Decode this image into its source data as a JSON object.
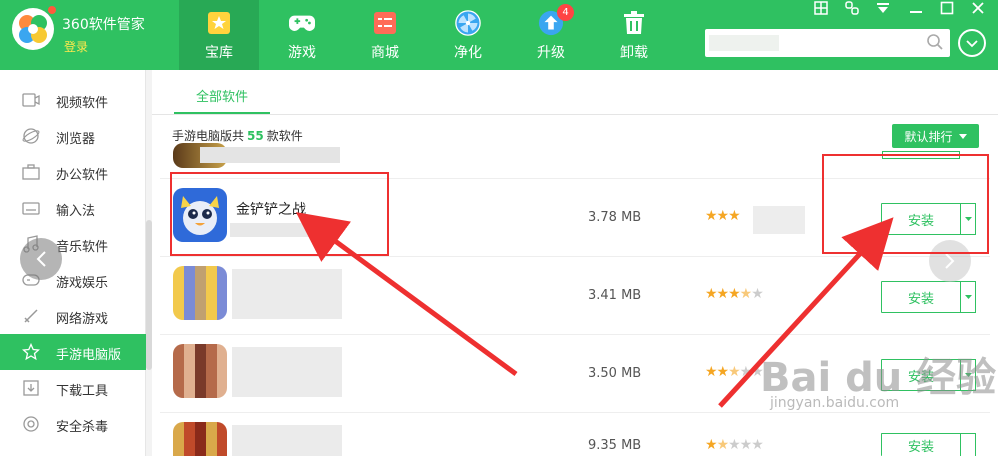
{
  "app": {
    "brand": "360软件管家",
    "login_label": "登录"
  },
  "tabs": [
    {
      "label": "宝库",
      "icon": "star-icon"
    },
    {
      "label": "游戏",
      "icon": "gamepad-icon"
    },
    {
      "label": "商城",
      "icon": "store-icon"
    },
    {
      "label": "净化",
      "icon": "purify-icon"
    },
    {
      "label": "升级",
      "icon": "upgrade-icon",
      "badge": "4"
    },
    {
      "label": "卸载",
      "icon": "trash-icon"
    }
  ],
  "search": {
    "placeholder": ""
  },
  "sidebar": {
    "items": [
      {
        "label": "视频软件"
      },
      {
        "label": "浏览器"
      },
      {
        "label": "办公软件"
      },
      {
        "label": "输入法"
      },
      {
        "label": "音乐软件"
      },
      {
        "label": "游戏娱乐"
      },
      {
        "label": "网络游戏"
      },
      {
        "label": "手游电脑版",
        "active": true
      },
      {
        "label": "下载工具"
      },
      {
        "label": "安全杀毒"
      }
    ]
  },
  "main": {
    "subtab": "全部软件",
    "count_prefix": "手游电脑版共",
    "count": "55",
    "count_suffix": "款软件",
    "sort_label": "默认排行"
  },
  "apps": [
    {
      "name": "金铲铲之战",
      "size": "3.78 MB",
      "stars": 3,
      "install": "安装"
    },
    {
      "name": "",
      "size": "3.41 MB",
      "stars": 3.5,
      "install": "安装"
    },
    {
      "name": "",
      "size": "3.50 MB",
      "stars": 2.5,
      "install": "安装"
    },
    {
      "name": "",
      "size": "9.35 MB",
      "stars": 1.5,
      "install": "安装"
    }
  ],
  "watermark": {
    "main": "Bai du 经验",
    "sub": "jingyan.baidu.com"
  },
  "colors": {
    "brand_green": "#2fc161",
    "annotation_red": "#ee3030",
    "star": "#f5a623"
  }
}
